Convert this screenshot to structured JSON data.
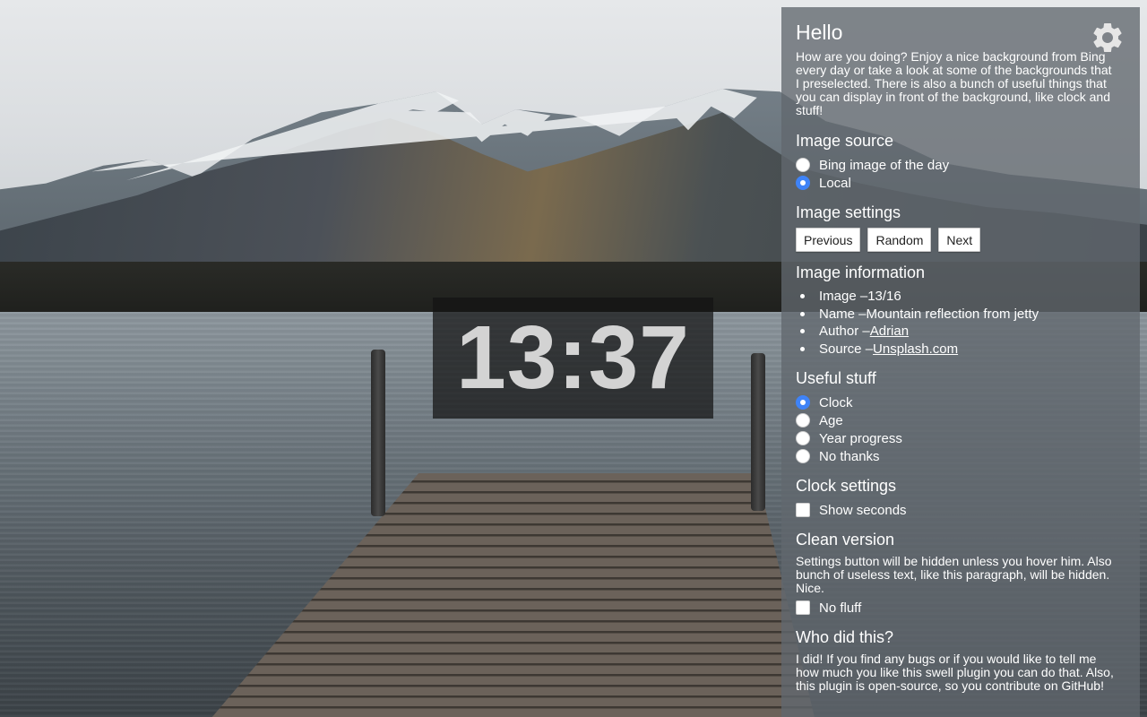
{
  "clock": {
    "time": "13:37"
  },
  "panel": {
    "title": "Hello",
    "intro": "How are you doing? Enjoy a nice background from Bing every day or take a look at some of the backgrounds that I preselected. There is also a bunch of useful things that you can display in front of the background, like clock and stuff!",
    "settings_icon": "gear-icon",
    "image_source": {
      "heading": "Image source",
      "options": [
        {
          "label": "Bing image of the day",
          "selected": false
        },
        {
          "label": "Local",
          "selected": true
        }
      ]
    },
    "image_settings": {
      "heading": "Image settings",
      "buttons": [
        "Previous",
        "Random",
        "Next"
      ]
    },
    "image_information": {
      "heading": "Image information",
      "image_prefix": "Image – ",
      "image_value": "13/16",
      "name_prefix": "Name – ",
      "name_value": "Mountain reflection from jetty",
      "author_prefix": "Author – ",
      "author_link": "Adrian",
      "source_prefix": "Source – ",
      "source_link": "Unsplash.com"
    },
    "useful_stuff": {
      "heading": "Useful stuff",
      "options": [
        {
          "label": "Clock",
          "selected": true
        },
        {
          "label": "Age",
          "selected": false
        },
        {
          "label": "Year progress",
          "selected": false
        },
        {
          "label": "No thanks",
          "selected": false
        }
      ]
    },
    "clock_settings": {
      "heading": "Clock settings",
      "show_seconds_label": "Show seconds",
      "show_seconds_checked": false
    },
    "clean_version": {
      "heading": "Clean version",
      "description": "Settings button will be hidden unless you hover him. Also bunch of useless text, like this paragraph, will be hidden. Nice.",
      "no_fluff_label": "No fluff",
      "no_fluff_checked": false
    },
    "who_did_this": {
      "heading": "Who did this?",
      "text": "I did! If you find any bugs or if you would like to tell me how much you like this swell plugin you can do that. Also, this plugin is open-source, so you contribute on GitHub!"
    }
  },
  "colors": {
    "accent": "#3f83f7",
    "panel_bg": "#62686e",
    "clock_bg": "#141414",
    "clock_text": "#d3d3d3"
  }
}
